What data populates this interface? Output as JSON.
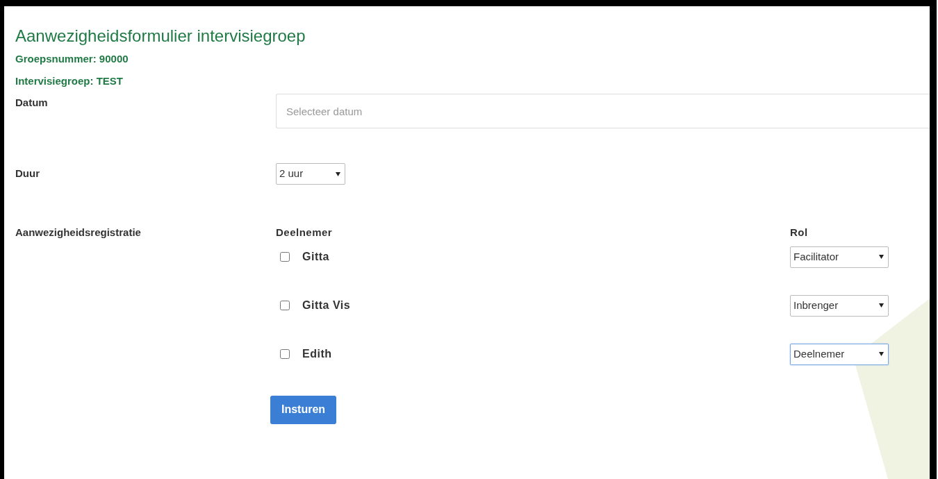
{
  "title": "Aanwezigheidsformulier intervisiegroep",
  "group_number": "Groepsnummer: 90000",
  "group_name": "Intervisiegroep: TEST",
  "date": {
    "label": "Datum",
    "placeholder": "Selecteer datum"
  },
  "duration": {
    "label": "Duur",
    "value": "2 uur"
  },
  "attendance": {
    "label": "Aanwezigheidsregistratie",
    "participant_header": "Deelnemer",
    "role_header": "Rol",
    "participants": [
      {
        "name": "Gitta",
        "checked": false,
        "role": "Facilitator",
        "focused": false
      },
      {
        "name": "Gitta Vis",
        "checked": false,
        "role": "Inbrenger",
        "focused": false
      },
      {
        "name": "Edith",
        "checked": false,
        "role": "Deelnemer",
        "focused": true
      }
    ]
  },
  "submit": "Insturen"
}
